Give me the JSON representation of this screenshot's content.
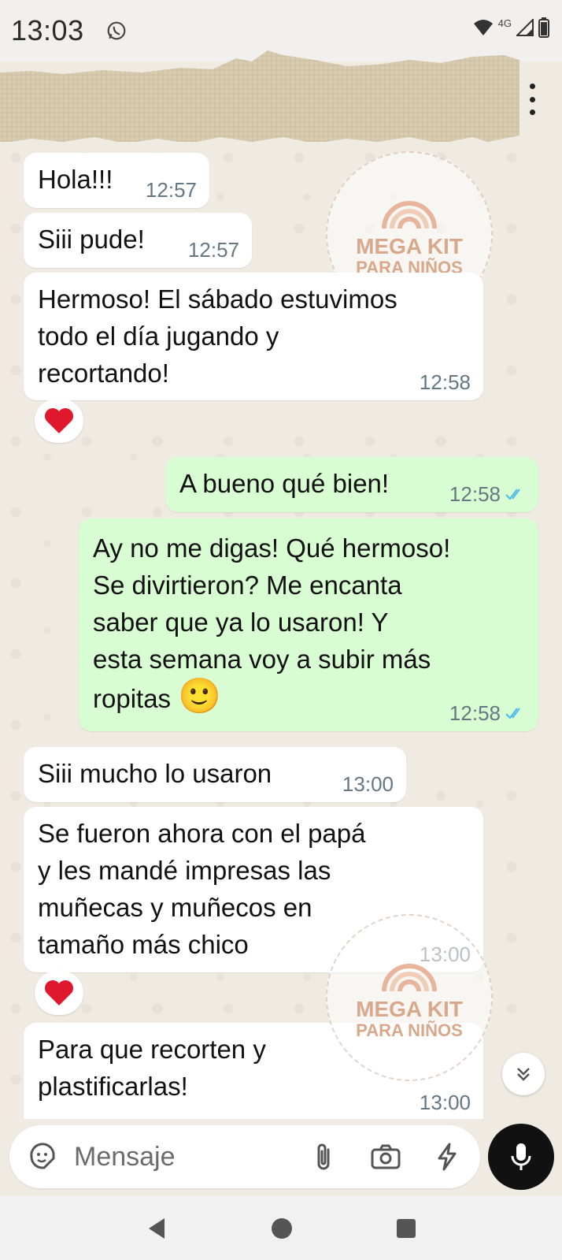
{
  "status_bar": {
    "time": "13:03",
    "network": "4G"
  },
  "composer": {
    "placeholder": "Mensaje"
  },
  "watermark": {
    "title": "MEGA KIT",
    "subtitle": "PARA NIÑOS"
  },
  "messages": [
    {
      "direction": "in",
      "text": "Hola!!!",
      "time": "12:57"
    },
    {
      "direction": "in",
      "text": "Siii pude!",
      "time": "12:57"
    },
    {
      "direction": "in",
      "text": "Hermoso! El sábado estuvimos\ntodo el día jugando y\nrecortando!",
      "time": "12:58",
      "reaction": "❤"
    },
    {
      "direction": "out",
      "text": "A bueno qué bien!",
      "time": "12:58",
      "read": true
    },
    {
      "direction": "out",
      "text": "Ay no me digas! Qué hermoso!\nSe divirtieron? Me encanta\nsaber que ya lo usaron! Y\nesta semana voy a subir más\nropitas",
      "emoji": "🙂",
      "time": "12:58",
      "read": true
    },
    {
      "direction": "in",
      "text": "Siii mucho lo usaron",
      "time": "13:00"
    },
    {
      "direction": "in",
      "text": "Se fueron ahora con el papá\ny les mandé impresas las\nmuñecas y muñecos en\ntamaño más chico",
      "time": "13:00",
      "reaction": "❤"
    },
    {
      "direction": "in",
      "text": "Para que recorten y\nplastificarlas!",
      "time": "13:00"
    }
  ],
  "colors": {
    "incoming": "#ffffff",
    "outgoing": "#d9fdd3",
    "read_ticks": "#53bdeb",
    "heart": "#e0182d",
    "chat_bg": "#efeae2"
  }
}
